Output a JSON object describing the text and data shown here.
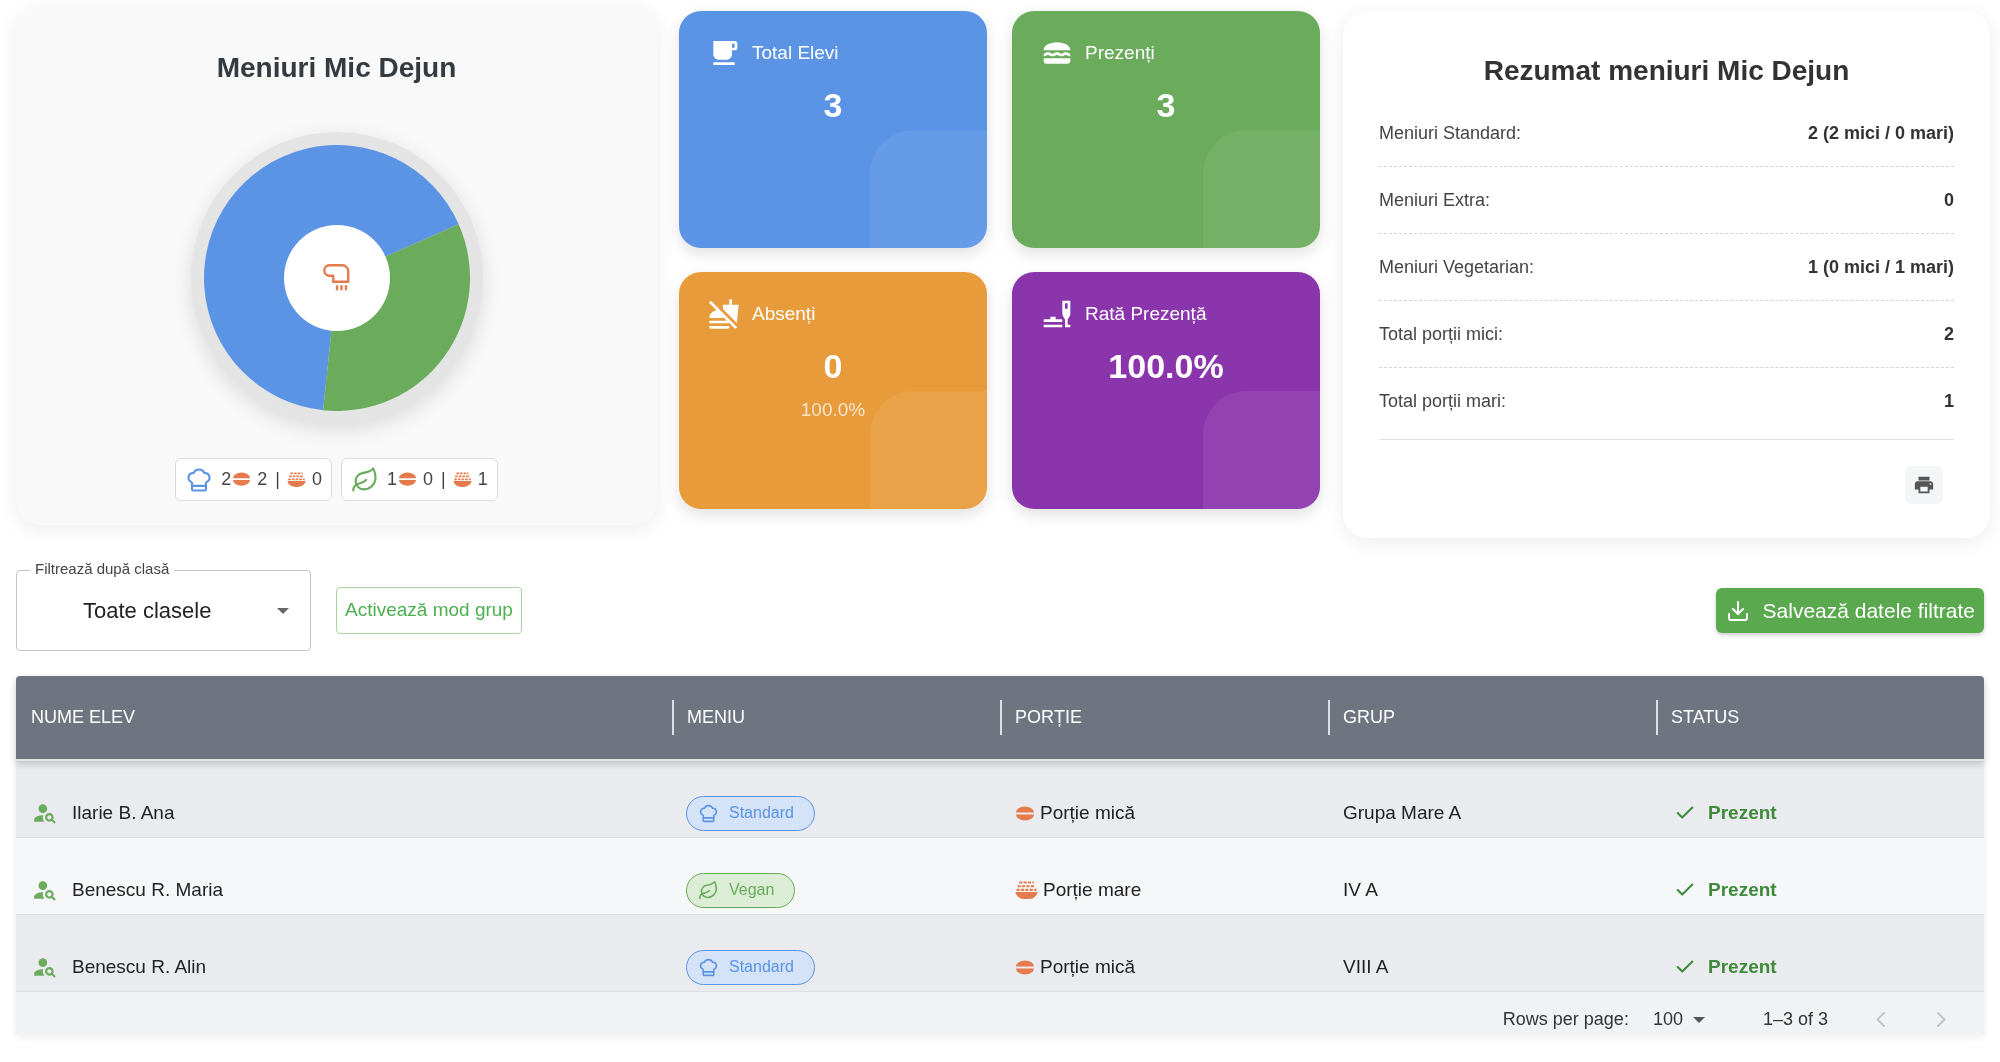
{
  "breakfast_chart": {
    "title": "Meniuri Mic Dejun",
    "chart_data": {
      "type": "donut",
      "values": [
        66.7,
        33.3
      ]
    },
    "legend": [
      {
        "kind": "standard",
        "color": "#5b93e5",
        "total": "2",
        "small": "2",
        "separator": "|",
        "large": "0"
      },
      {
        "kind": "vegan",
        "color": "#6aab5c",
        "total": "1",
        "small": "0",
        "separator": "|",
        "large": "1"
      }
    ]
  },
  "stat_cards": [
    {
      "kind": "total",
      "color": "#5b93e5",
      "label": "Total Elevi",
      "value": "3"
    },
    {
      "kind": "present",
      "color": "#6aab5c",
      "label": "Prezenți",
      "value": "3"
    },
    {
      "kind": "absent",
      "color": "#e79b3a",
      "label": "Absenți",
      "value": "0",
      "note": "100.0%"
    },
    {
      "kind": "rate",
      "color": "#8a35ab",
      "label": "Rată Prezență",
      "value": "100.0%"
    }
  ],
  "summary": {
    "title": "Rezumat meniuri Mic Dejun",
    "rows": [
      {
        "label": "Meniuri Standard:",
        "value": "2 (2 mici / 0 mari)"
      },
      {
        "label": "Meniuri Extra:",
        "value": "0"
      },
      {
        "label": "Meniuri Vegetarian:",
        "value": "1 (0 mici / 1 mari)"
      },
      {
        "label": "Total porții mici:",
        "value": "2"
      },
      {
        "label": "Total porții mari:",
        "value": "1"
      }
    ]
  },
  "filter": {
    "label": "Filtrează după clasă",
    "value": "Toate clasele"
  },
  "group_mode_button": "Activează mod grup",
  "export_button": "Salvează datele filtrate",
  "table": {
    "columns": [
      "NUME ELEV",
      "MENIU",
      "PORȚIE",
      "GRUP",
      "STATUS"
    ],
    "rows": [
      {
        "name": "Ilarie B. Ana",
        "menu": {
          "kind": "standard",
          "label": "Standard"
        },
        "portion": {
          "kind": "small",
          "label": "Porție mică"
        },
        "group": "Grupa Mare A",
        "status": {
          "kind": "present",
          "label": "Prezent"
        }
      },
      {
        "name": "Benescu R. Maria",
        "menu": {
          "kind": "vegan",
          "label": "Vegan"
        },
        "portion": {
          "kind": "large",
          "label": "Porție mare"
        },
        "group": "IV A",
        "status": {
          "kind": "present",
          "label": "Prezent"
        }
      },
      {
        "name": "Benescu R. Alin",
        "menu": {
          "kind": "standard",
          "label": "Standard"
        },
        "portion": {
          "kind": "small",
          "label": "Porție mică"
        },
        "group": "VIII A",
        "status": {
          "kind": "present",
          "label": "Prezent"
        }
      }
    ]
  },
  "pagination": {
    "rows_per_page_label": "Rows per page:",
    "rows_per_page": "100",
    "range": "1–3 of 3",
    "previous": {
      "disabled": true
    },
    "next": {
      "disabled": true
    }
  }
}
